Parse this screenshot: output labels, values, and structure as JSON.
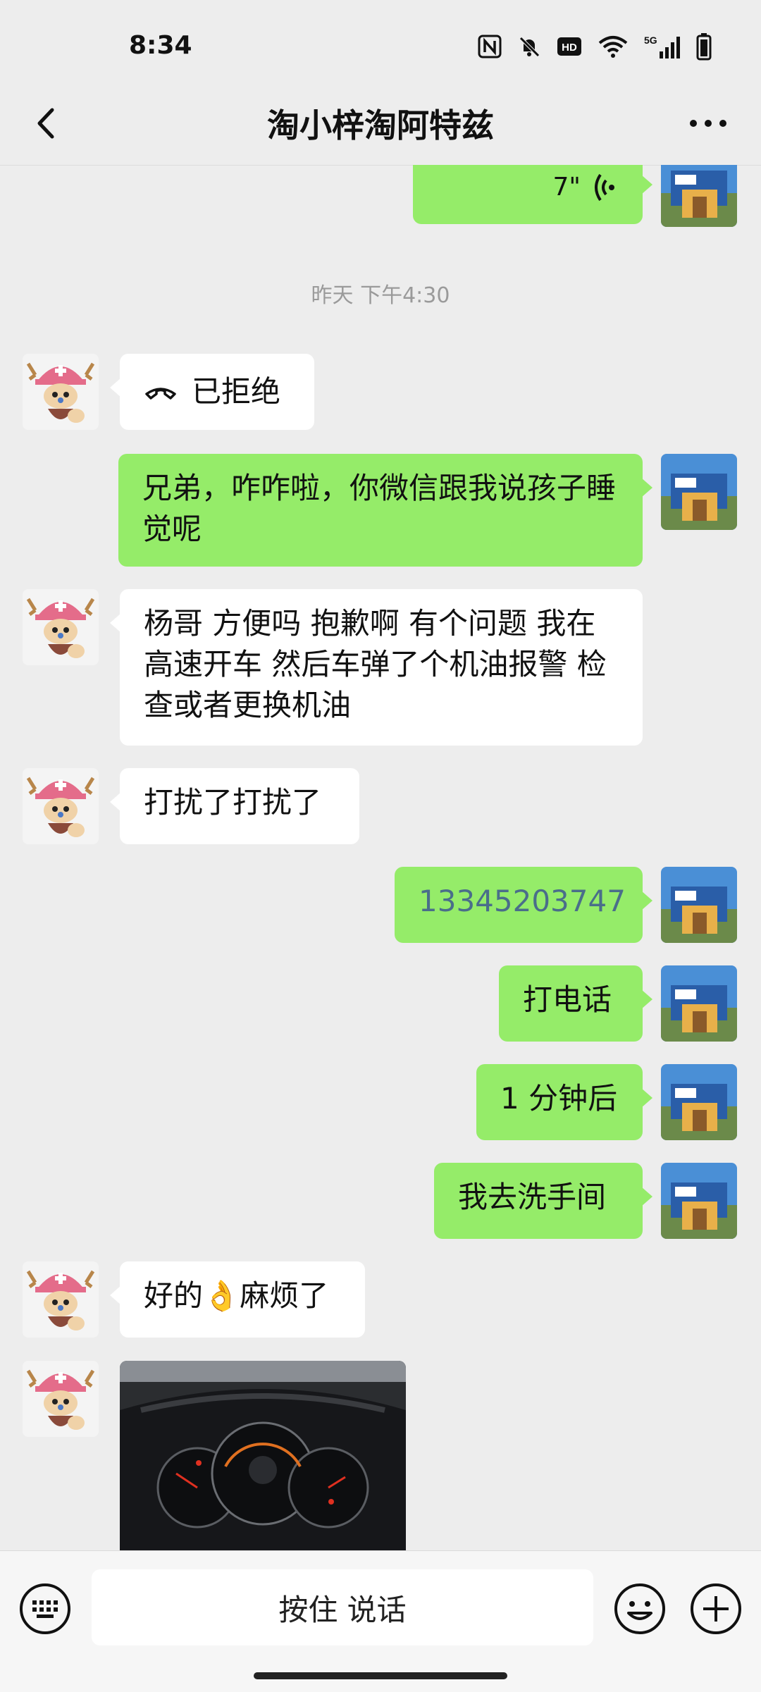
{
  "status": {
    "time": "8:34",
    "network": "5G"
  },
  "header": {
    "title": "淘小梓淘阿特兹"
  },
  "messages": {
    "voice_duration": "7\"",
    "timestamp": "昨天 下午4:30",
    "m1": "已拒绝",
    "m2": "兄弟，咋咋啦，你微信跟我说孩子睡觉呢",
    "m3": "杨哥 方便吗 抱歉啊 有个问题 我在高速开车 然后车弹了个机油报警 检查或者更换机油",
    "m4": "打扰了打扰了",
    "m5": "13345203747",
    "m6": "打电话",
    "m7": "1 分钟后",
    "m8": "我去洗手间",
    "m9": "好的👌麻烦了"
  },
  "input": {
    "voice_label": "按住 说话"
  },
  "icons": {
    "back": "back-arrow-icon",
    "more": "more-dots-icon",
    "keyboard": "keyboard-icon",
    "emoji": "emoji-icon",
    "plus": "plus-icon",
    "call": "hangup-phone-icon",
    "voice": "voice-wave-icon"
  },
  "colors": {
    "self_bubble": "#95ec69",
    "other_bubble": "#ffffff",
    "background": "#ededed",
    "link": "#4a6e8a"
  }
}
